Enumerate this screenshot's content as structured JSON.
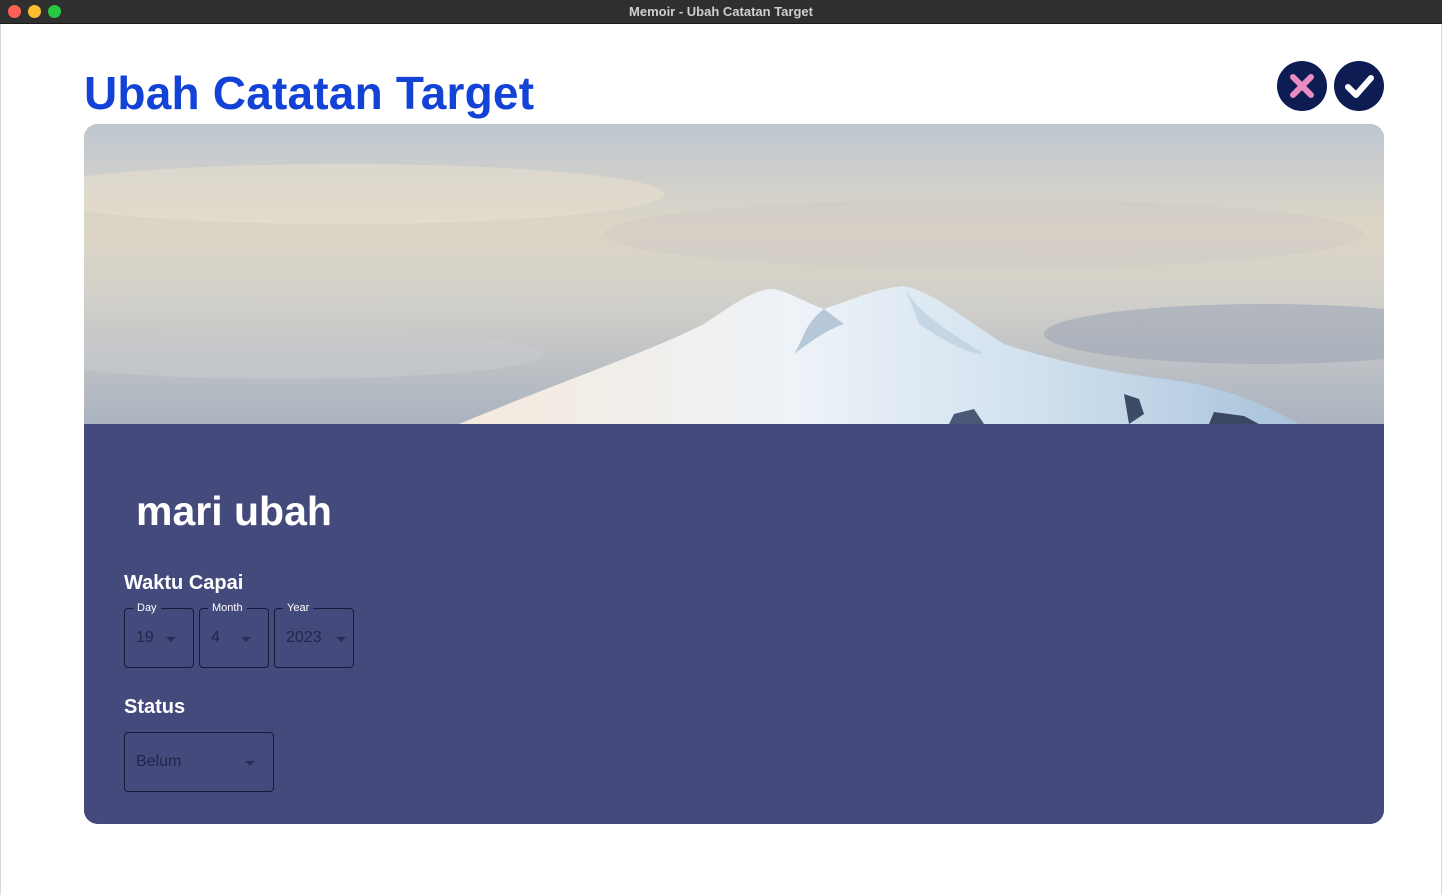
{
  "window": {
    "title": "Memoir - Ubah Catatan Target"
  },
  "header": {
    "title": "Ubah Catatan Target",
    "cancel_icon": "close-icon",
    "save_icon": "check-icon"
  },
  "banner": {
    "image": "snow-capped-mountain-photo"
  },
  "form": {
    "title_value": "mari ubah",
    "time_label": "Waktu Capai",
    "date": {
      "day_label": "Day",
      "day_value": "19",
      "month_label": "Month",
      "month_value": "4",
      "year_label": "Year",
      "year_value": "2023"
    },
    "status_label": "Status",
    "status_value": "Belum"
  },
  "colors": {
    "title_blue": "#1242d6",
    "button_navy": "#0d1c52",
    "cancel_pink": "#e88cc1",
    "card_purple": "#454a7d"
  }
}
